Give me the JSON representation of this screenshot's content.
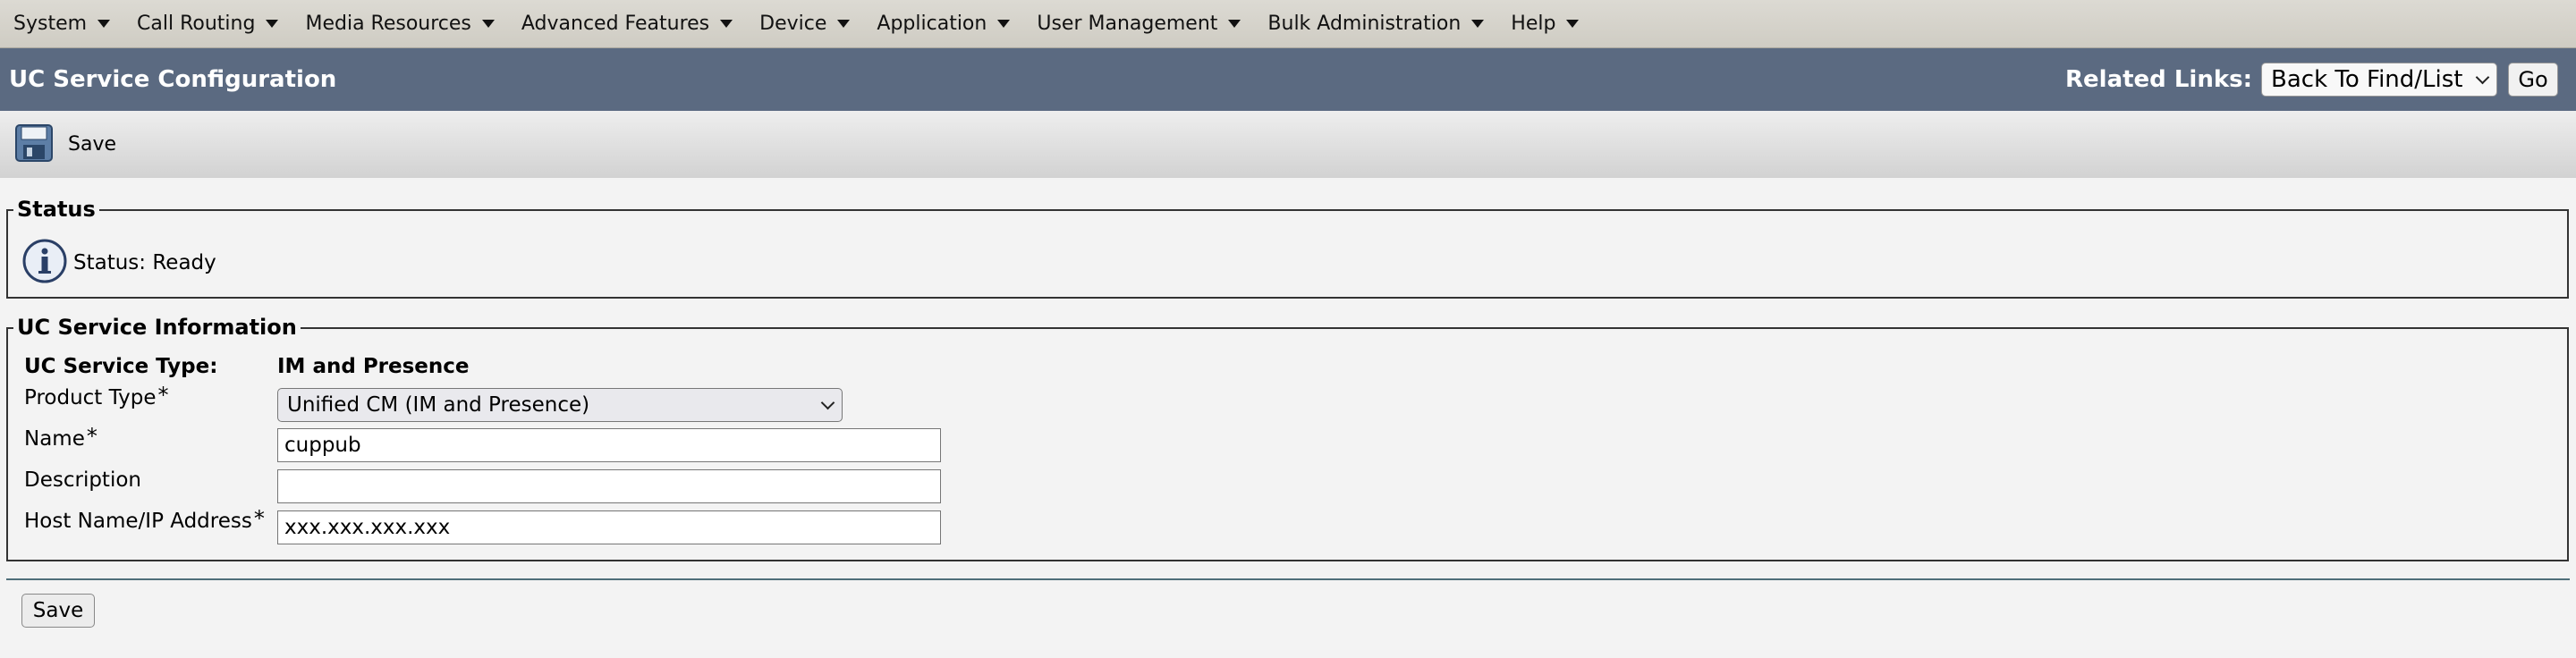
{
  "menu": [
    {
      "label": "System"
    },
    {
      "label": "Call Routing"
    },
    {
      "label": "Media Resources"
    },
    {
      "label": "Advanced Features"
    },
    {
      "label": "Device"
    },
    {
      "label": "Application"
    },
    {
      "label": "User Management"
    },
    {
      "label": "Bulk Administration"
    },
    {
      "label": "Help"
    }
  ],
  "header": {
    "title": "UC Service Configuration",
    "related_links_label": "Related Links:",
    "related_links_value": "Back To Find/List",
    "go_label": "Go"
  },
  "toolbar": {
    "save_label": "Save",
    "save_icon": "floppy-disk-icon"
  },
  "status": {
    "legend": "Status",
    "icon": "info-icon",
    "text": "Status: Ready"
  },
  "info": {
    "legend": "UC Service Information",
    "service_type_label": "UC Service Type:",
    "service_type_value": "IM and Presence",
    "product_type_label": "Product Type",
    "product_type_value": "Unified CM (IM and Presence)",
    "name_label": "Name",
    "name_value": "cuppub",
    "description_label": "Description",
    "description_value": "",
    "host_label": "Host Name/IP Address",
    "host_value": "xxx.xxx.xxx.xxx",
    "required_mark": "*"
  },
  "footer": {
    "save_label": "Save"
  },
  "colors": {
    "menu_bg": "#d6d3cb",
    "title_bg": "#5b6a81",
    "page_bg": "#f3f3f3"
  }
}
